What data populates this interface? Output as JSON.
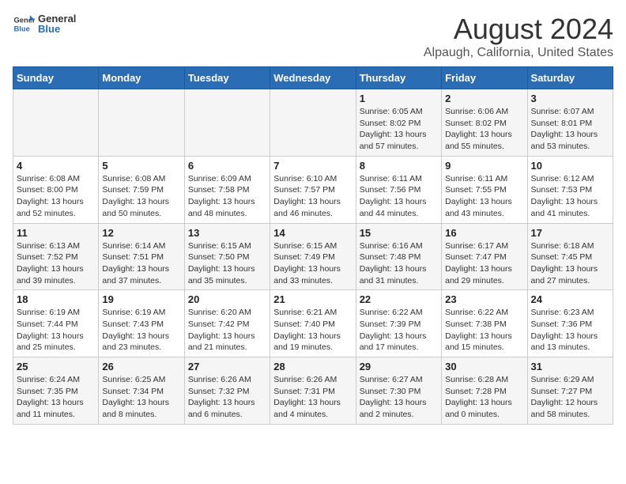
{
  "header": {
    "logo_general": "General",
    "logo_blue": "Blue",
    "main_title": "August 2024",
    "subtitle": "Alpaugh, California, United States"
  },
  "weekdays": [
    "Sunday",
    "Monday",
    "Tuesday",
    "Wednesday",
    "Thursday",
    "Friday",
    "Saturday"
  ],
  "weeks": [
    [
      {
        "day": "",
        "detail": ""
      },
      {
        "day": "",
        "detail": ""
      },
      {
        "day": "",
        "detail": ""
      },
      {
        "day": "",
        "detail": ""
      },
      {
        "day": "1",
        "detail": "Sunrise: 6:05 AM\nSunset: 8:02 PM\nDaylight: 13 hours and 57 minutes."
      },
      {
        "day": "2",
        "detail": "Sunrise: 6:06 AM\nSunset: 8:02 PM\nDaylight: 13 hours and 55 minutes."
      },
      {
        "day": "3",
        "detail": "Sunrise: 6:07 AM\nSunset: 8:01 PM\nDaylight: 13 hours and 53 minutes."
      }
    ],
    [
      {
        "day": "4",
        "detail": "Sunrise: 6:08 AM\nSunset: 8:00 PM\nDaylight: 13 hours and 52 minutes."
      },
      {
        "day": "5",
        "detail": "Sunrise: 6:08 AM\nSunset: 7:59 PM\nDaylight: 13 hours and 50 minutes."
      },
      {
        "day": "6",
        "detail": "Sunrise: 6:09 AM\nSunset: 7:58 PM\nDaylight: 13 hours and 48 minutes."
      },
      {
        "day": "7",
        "detail": "Sunrise: 6:10 AM\nSunset: 7:57 PM\nDaylight: 13 hours and 46 minutes."
      },
      {
        "day": "8",
        "detail": "Sunrise: 6:11 AM\nSunset: 7:56 PM\nDaylight: 13 hours and 44 minutes."
      },
      {
        "day": "9",
        "detail": "Sunrise: 6:11 AM\nSunset: 7:55 PM\nDaylight: 13 hours and 43 minutes."
      },
      {
        "day": "10",
        "detail": "Sunrise: 6:12 AM\nSunset: 7:53 PM\nDaylight: 13 hours and 41 minutes."
      }
    ],
    [
      {
        "day": "11",
        "detail": "Sunrise: 6:13 AM\nSunset: 7:52 PM\nDaylight: 13 hours and 39 minutes."
      },
      {
        "day": "12",
        "detail": "Sunrise: 6:14 AM\nSunset: 7:51 PM\nDaylight: 13 hours and 37 minutes."
      },
      {
        "day": "13",
        "detail": "Sunrise: 6:15 AM\nSunset: 7:50 PM\nDaylight: 13 hours and 35 minutes."
      },
      {
        "day": "14",
        "detail": "Sunrise: 6:15 AM\nSunset: 7:49 PM\nDaylight: 13 hours and 33 minutes."
      },
      {
        "day": "15",
        "detail": "Sunrise: 6:16 AM\nSunset: 7:48 PM\nDaylight: 13 hours and 31 minutes."
      },
      {
        "day": "16",
        "detail": "Sunrise: 6:17 AM\nSunset: 7:47 PM\nDaylight: 13 hours and 29 minutes."
      },
      {
        "day": "17",
        "detail": "Sunrise: 6:18 AM\nSunset: 7:45 PM\nDaylight: 13 hours and 27 minutes."
      }
    ],
    [
      {
        "day": "18",
        "detail": "Sunrise: 6:19 AM\nSunset: 7:44 PM\nDaylight: 13 hours and 25 minutes."
      },
      {
        "day": "19",
        "detail": "Sunrise: 6:19 AM\nSunset: 7:43 PM\nDaylight: 13 hours and 23 minutes."
      },
      {
        "day": "20",
        "detail": "Sunrise: 6:20 AM\nSunset: 7:42 PM\nDaylight: 13 hours and 21 minutes."
      },
      {
        "day": "21",
        "detail": "Sunrise: 6:21 AM\nSunset: 7:40 PM\nDaylight: 13 hours and 19 minutes."
      },
      {
        "day": "22",
        "detail": "Sunrise: 6:22 AM\nSunset: 7:39 PM\nDaylight: 13 hours and 17 minutes."
      },
      {
        "day": "23",
        "detail": "Sunrise: 6:22 AM\nSunset: 7:38 PM\nDaylight: 13 hours and 15 minutes."
      },
      {
        "day": "24",
        "detail": "Sunrise: 6:23 AM\nSunset: 7:36 PM\nDaylight: 13 hours and 13 minutes."
      }
    ],
    [
      {
        "day": "25",
        "detail": "Sunrise: 6:24 AM\nSunset: 7:35 PM\nDaylight: 13 hours and 11 minutes."
      },
      {
        "day": "26",
        "detail": "Sunrise: 6:25 AM\nSunset: 7:34 PM\nDaylight: 13 hours and 8 minutes."
      },
      {
        "day": "27",
        "detail": "Sunrise: 6:26 AM\nSunset: 7:32 PM\nDaylight: 13 hours and 6 minutes."
      },
      {
        "day": "28",
        "detail": "Sunrise: 6:26 AM\nSunset: 7:31 PM\nDaylight: 13 hours and 4 minutes."
      },
      {
        "day": "29",
        "detail": "Sunrise: 6:27 AM\nSunset: 7:30 PM\nDaylight: 13 hours and 2 minutes."
      },
      {
        "day": "30",
        "detail": "Sunrise: 6:28 AM\nSunset: 7:28 PM\nDaylight: 13 hours and 0 minutes."
      },
      {
        "day": "31",
        "detail": "Sunrise: 6:29 AM\nSunset: 7:27 PM\nDaylight: 12 hours and 58 minutes."
      }
    ]
  ]
}
